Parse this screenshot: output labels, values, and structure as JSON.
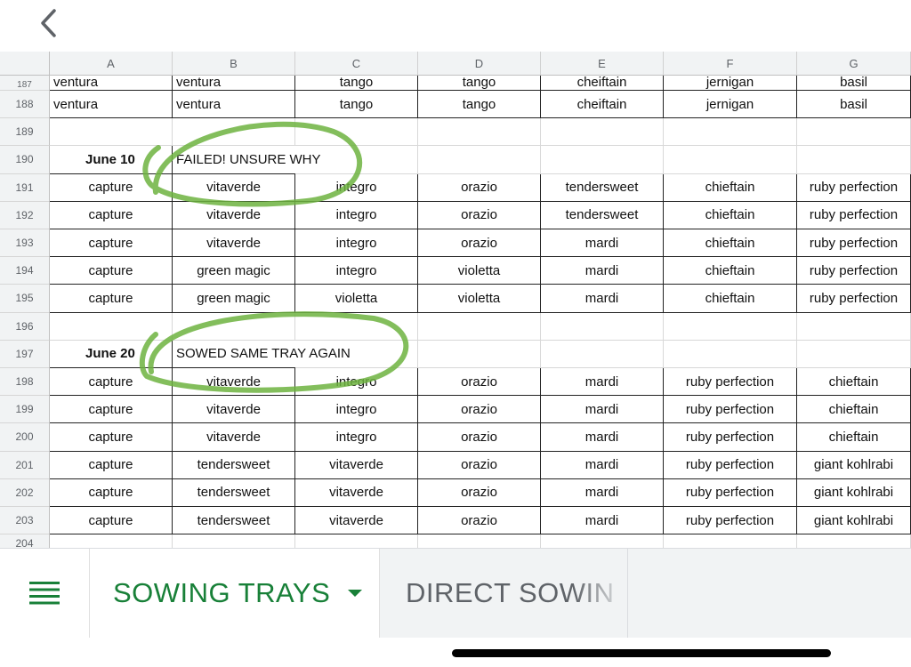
{
  "nav": {
    "back_icon": "chevron-left-icon"
  },
  "columns": [
    "A",
    "B",
    "C",
    "D",
    "E",
    "F",
    "G"
  ],
  "partial_top_row": {
    "number": "187",
    "cells": [
      "ventura",
      "ventura",
      "tango",
      "tango",
      "cheiftain",
      "jernigan",
      "basil"
    ]
  },
  "rows": [
    {
      "number": "188",
      "cells": [
        "ventura",
        "ventura",
        "tango",
        "tango",
        "cheiftain",
        "jernigan",
        "basil"
      ]
    },
    {
      "number": "189",
      "cells": [
        "",
        "",
        "",
        "",
        "",
        "",
        ""
      ]
    },
    {
      "number": "190",
      "cells": [
        "June 10",
        "FAILED! UNSURE WHY",
        "",
        "",
        "",
        "",
        ""
      ]
    },
    {
      "number": "191",
      "cells": [
        "capture",
        "vitaverde",
        "integro",
        "orazio",
        "tendersweet",
        "chieftain",
        "ruby perfection"
      ]
    },
    {
      "number": "192",
      "cells": [
        "capture",
        "vitaverde",
        "integro",
        "orazio",
        "tendersweet",
        "chieftain",
        "ruby perfection"
      ]
    },
    {
      "number": "193",
      "cells": [
        "capture",
        "vitaverde",
        "integro",
        "orazio",
        "mardi",
        "chieftain",
        "ruby perfection"
      ]
    },
    {
      "number": "194",
      "cells": [
        "capture",
        "green magic",
        "integro",
        "violetta",
        "mardi",
        "chieftain",
        "ruby perfection"
      ]
    },
    {
      "number": "195",
      "cells": [
        "capture",
        "green magic",
        "violetta",
        "violetta",
        "mardi",
        "chieftain",
        "ruby perfection"
      ]
    },
    {
      "number": "196",
      "cells": [
        "",
        "",
        "",
        "",
        "",
        "",
        ""
      ]
    },
    {
      "number": "197",
      "cells": [
        "June 20",
        "SOWED SAME TRAY AGAIN",
        "",
        "",
        "",
        "",
        ""
      ]
    },
    {
      "number": "198",
      "cells": [
        "capture",
        "vitaverde",
        "integro",
        "orazio",
        "mardi",
        "ruby perfection",
        "chieftain"
      ]
    },
    {
      "number": "199",
      "cells": [
        "capture",
        "vitaverde",
        "integro",
        "orazio",
        "mardi",
        "ruby perfection",
        "chieftain"
      ]
    },
    {
      "number": "200",
      "cells": [
        "capture",
        "vitaverde",
        "integro",
        "orazio",
        "mardi",
        "ruby perfection",
        "chieftain"
      ]
    },
    {
      "number": "201",
      "cells": [
        "capture",
        "tendersweet",
        "vitaverde",
        "orazio",
        "mardi",
        "ruby perfection",
        "giant kohlrabi"
      ]
    },
    {
      "number": "202",
      "cells": [
        "capture",
        "tendersweet",
        "vitaverde",
        "orazio",
        "mardi",
        "ruby perfection",
        "giant kohlrabi"
      ]
    },
    {
      "number": "203",
      "cells": [
        "capture",
        "tendersweet",
        "vitaverde",
        "orazio",
        "mardi",
        "ruby perfection",
        "giant kohlrabi"
      ]
    }
  ],
  "partial_bottom_row": {
    "number": "204"
  },
  "tabs": [
    {
      "label": "SOWING TRAYS",
      "active": true
    },
    {
      "label": "DIRECT SOWIN",
      "active": false
    }
  ],
  "menu_icon": "hamburger-menu-icon",
  "colors": {
    "accent": "#188038",
    "highlight_stroke": "#6db33f"
  }
}
